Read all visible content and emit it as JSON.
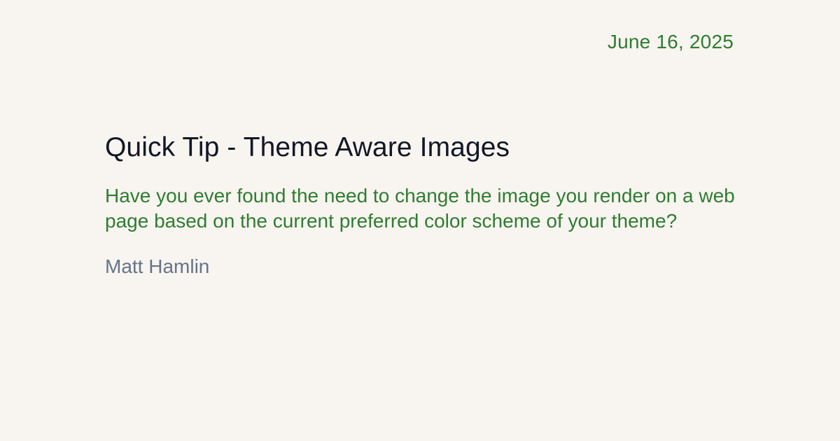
{
  "post": {
    "date": "June 16, 2025",
    "title": "Quick Tip - Theme Aware Images",
    "description": "Have you ever found the need to change the image you render on a web page based on the current preferred color scheme of your theme?",
    "author": "Matt Hamlin"
  },
  "colors": {
    "background": "#f8f4ef",
    "accent": "#2e7d32",
    "title": "#111827",
    "author": "#64748b"
  }
}
